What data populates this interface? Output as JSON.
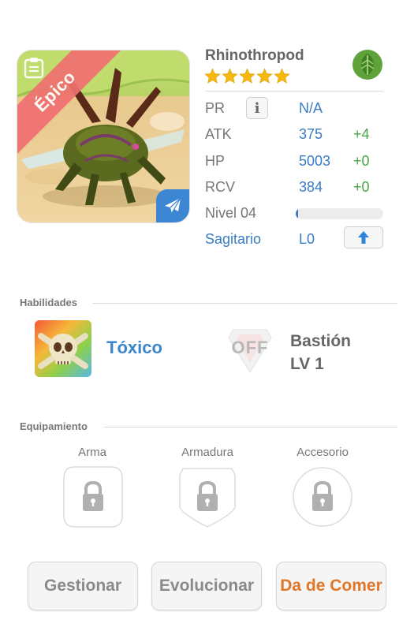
{
  "monster": {
    "rarity": "Épico",
    "name": "Rhinothropod",
    "stars": 5,
    "element_icon": "leaf-icon",
    "type_icon": "airplane-icon",
    "colors": {
      "accent_blue": "#3a7cc4",
      "bonus_green": "#4aa34a",
      "ribbon_red": "#f07070",
      "feed_orange": "#e0762a"
    }
  },
  "stats": {
    "pr": {
      "label": "PR",
      "value": "N/A"
    },
    "atk": {
      "label": "ATK",
      "value": "375",
      "bonus": "+4"
    },
    "hp": {
      "label": "HP",
      "value": "5003",
      "bonus": "+0"
    },
    "rcv": {
      "label": "RCV",
      "value": "384",
      "bonus": "+0"
    },
    "level": {
      "label": "Nivel 04",
      "progress": 0.02
    },
    "sign": {
      "label": "Sagitario",
      "value": "L0"
    }
  },
  "skills": {
    "title": "Habilidades",
    "active": {
      "name": "Tóxico",
      "icon": "skull-icon"
    },
    "passive": {
      "status": "OFF",
      "name": "Bastión",
      "level": "LV 1",
      "icon": "shield-icon"
    }
  },
  "equipment": {
    "title": "Equipamiento",
    "slots": [
      {
        "label": "Arma",
        "icon": "lock-icon"
      },
      {
        "label": "Armadura",
        "icon": "lock-icon"
      },
      {
        "label": "Accesorio",
        "icon": "lock-icon"
      }
    ]
  },
  "actions": {
    "manage": "Gestionar",
    "evolve": "Evolucionar",
    "feed": "Da de Comer"
  }
}
